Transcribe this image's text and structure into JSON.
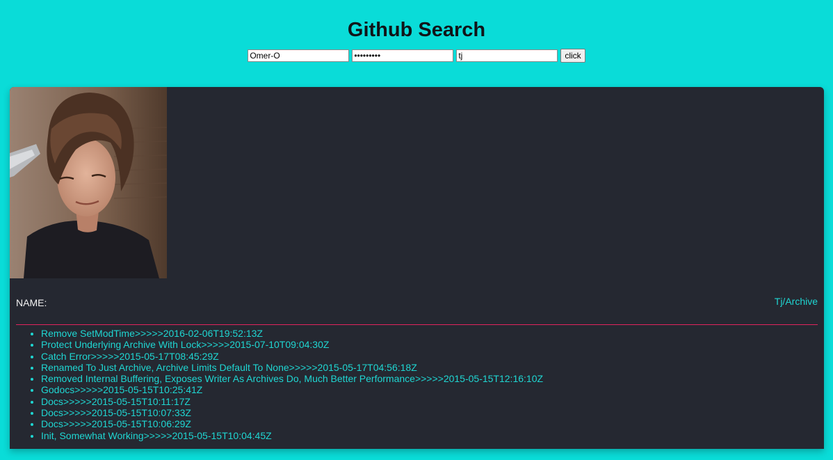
{
  "header": {
    "title": "Github Search"
  },
  "search": {
    "username_value": "Omer-O",
    "password_value": "secretpw1",
    "query_value": "tj",
    "button_label": "click"
  },
  "profile": {
    "name_label": "NAME:",
    "repo_link": "Tj/Archive"
  },
  "commits": [
    "Remove SetModTime>>>>>2016-02-06T19:52:13Z",
    "Protect Underlying Archive With Lock>>>>>2015-07-10T09:04:30Z",
    "Catch Error>>>>>2015-05-17T08:45:29Z",
    "Renamed To Just Archive, Archive Limits Default To None>>>>>2015-05-17T04:56:18Z",
    "Removed Internal Buffering, Exposes Writer As Archives Do, Much Better Performance>>>>>2015-05-15T12:16:10Z",
    "Godocs>>>>>2015-05-15T10:25:41Z",
    "Docs>>>>>2015-05-15T10:11:17Z",
    "Docs>>>>>2015-05-15T10:07:33Z",
    "Docs>>>>>2015-05-15T10:06:29Z",
    "Init, Somewhat Working>>>>>2015-05-15T10:04:45Z"
  ],
  "colors": {
    "background": "#0adcd8",
    "card": "#252831",
    "accent": "#1fd6d2",
    "divider": "#e0245e"
  }
}
